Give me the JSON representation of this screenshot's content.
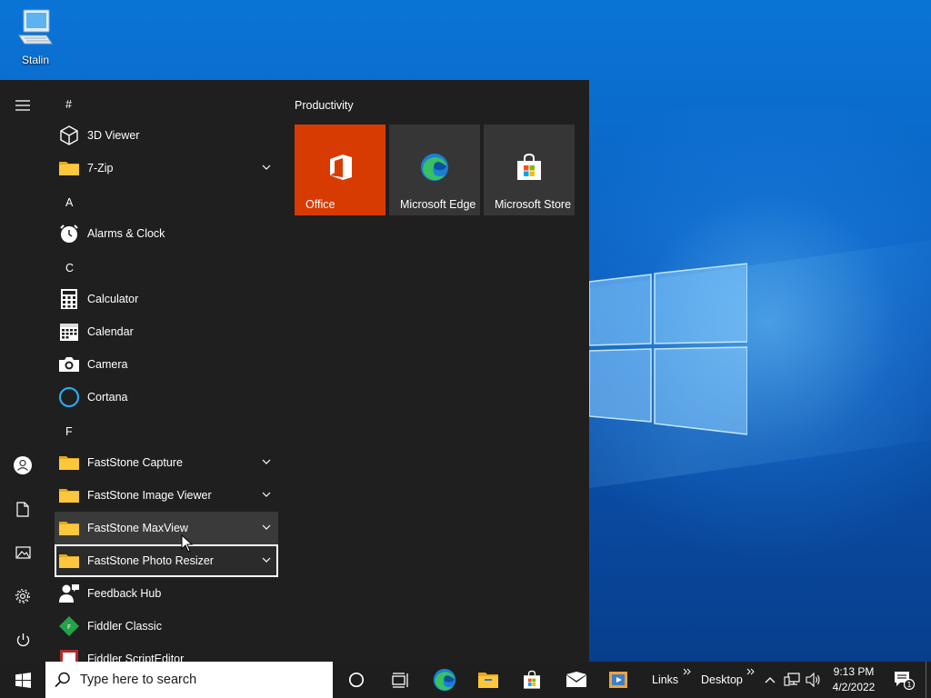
{
  "desktop": {
    "icons": [
      {
        "label": "Stalin",
        "icon": "computer-icon"
      }
    ]
  },
  "start_menu": {
    "rail": [
      "hamburger-menu-icon",
      "user-account-icon",
      "documents-icon",
      "pictures-icon",
      "settings-icon",
      "power-icon"
    ],
    "app_list": [
      {
        "kind": "letter",
        "text": "#"
      },
      {
        "kind": "app",
        "label": "3D Viewer",
        "icon": "cube-icon"
      },
      {
        "kind": "app",
        "label": "7-Zip",
        "icon": "folder-icon",
        "expandable": true
      },
      {
        "kind": "letter",
        "text": "A"
      },
      {
        "kind": "app",
        "label": "Alarms & Clock",
        "icon": "alarm-clock-icon"
      },
      {
        "kind": "letter",
        "text": "C"
      },
      {
        "kind": "app",
        "label": "Calculator",
        "icon": "calculator-icon"
      },
      {
        "kind": "app",
        "label": "Calendar",
        "icon": "calendar-icon"
      },
      {
        "kind": "app",
        "label": "Camera",
        "icon": "camera-icon"
      },
      {
        "kind": "app",
        "label": "Cortana",
        "icon": "cortana-icon"
      },
      {
        "kind": "letter",
        "text": "F"
      },
      {
        "kind": "app",
        "label": "FastStone Capture",
        "icon": "folder-icon",
        "expandable": true
      },
      {
        "kind": "app",
        "label": "FastStone Image Viewer",
        "icon": "folder-icon",
        "expandable": true
      },
      {
        "kind": "app",
        "label": "FastStone MaxView",
        "icon": "folder-icon",
        "expandable": true,
        "state": "hover"
      },
      {
        "kind": "app",
        "label": "FastStone Photo Resizer",
        "icon": "folder-icon",
        "expandable": true,
        "state": "focus"
      },
      {
        "kind": "app",
        "label": "Feedback Hub",
        "icon": "feedback-hub-icon"
      },
      {
        "kind": "app",
        "label": "Fiddler Classic",
        "icon": "fiddler-icon"
      },
      {
        "kind": "app",
        "label": "Fiddler ScriptEditor",
        "icon": "fiddler-script-editor-icon"
      }
    ],
    "tile_group": {
      "title": "Productivity",
      "tiles": [
        {
          "label": "Office",
          "icon": "office-icon",
          "color": "#d83b01"
        },
        {
          "label": "Microsoft Edge",
          "icon": "edge-icon",
          "color": "#363636"
        },
        {
          "label": "Microsoft Store",
          "icon": "store-icon",
          "color": "#363636"
        }
      ]
    }
  },
  "taskbar": {
    "search_placeholder": "Type here to search",
    "pinned": [
      "cortana-circle-icon",
      "task-view-icon",
      "edge-icon",
      "file-explorer-icon",
      "store-icon",
      "mail-icon",
      "media-player-icon"
    ],
    "toolbars": [
      "Links",
      "Desktop"
    ],
    "tray": {
      "icons": [
        "chevron-up-icon",
        "network-icon",
        "volume-icon"
      ],
      "time": "9:13 PM",
      "date": "4/2/2022",
      "notifications_count": "1"
    }
  },
  "colors": {
    "accent": "#0078d7",
    "start_bg": "#1f1f1f",
    "taskbar_bg": "#1e1e1e",
    "office_tile": "#d83b01"
  }
}
